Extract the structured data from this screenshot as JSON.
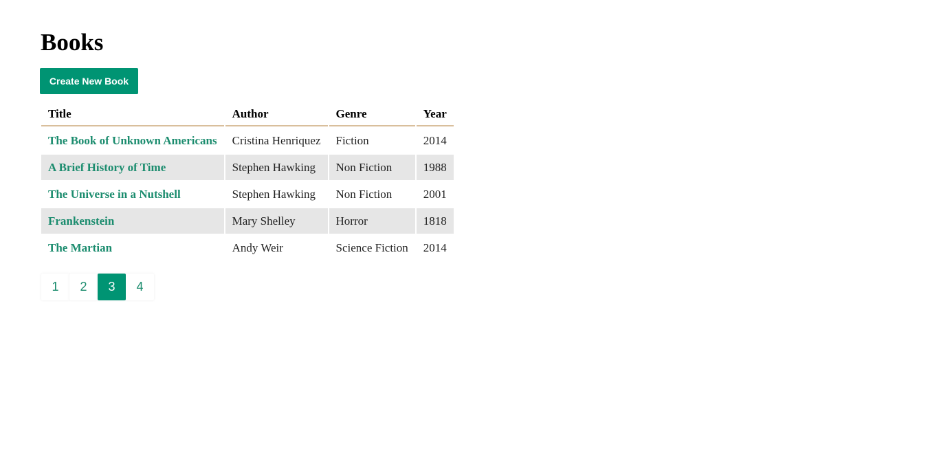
{
  "page": {
    "title": "Books",
    "create_button_label": "Create New Book"
  },
  "table": {
    "columns": [
      "Title",
      "Author",
      "Genre",
      "Year"
    ],
    "rows": [
      {
        "title": "The Book of Unknown Americans",
        "author": "Cristina Henriquez",
        "genre": "Fiction",
        "year": "2014"
      },
      {
        "title": "A Brief History of Time",
        "author": "Stephen Hawking",
        "genre": "Non Fiction",
        "year": "1988"
      },
      {
        "title": "The Universe in a Nutshell",
        "author": "Stephen Hawking",
        "genre": "Non Fiction",
        "year": "2001"
      },
      {
        "title": "Frankenstein",
        "author": "Mary Shelley",
        "genre": "Horror",
        "year": "1818"
      },
      {
        "title": "The Martian",
        "author": "Andy Weir",
        "genre": "Science Fiction",
        "year": "2014"
      }
    ]
  },
  "pagination": {
    "pages": [
      "1",
      "2",
      "3",
      "4"
    ],
    "current": "3"
  },
  "colors": {
    "accent": "#009473",
    "link": "#1b8c6e",
    "header_border": "#d9bf9c",
    "row_alt": "#e6e6e6"
  }
}
